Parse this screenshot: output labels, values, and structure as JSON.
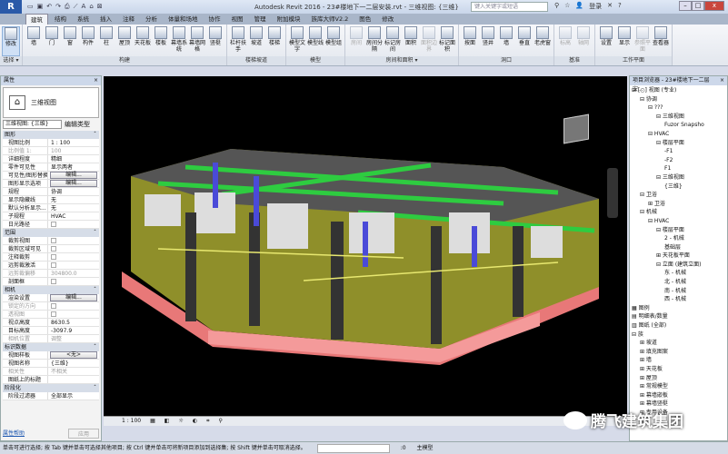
{
  "app": {
    "title": "Autodesk Revit 2016 -  23#楼地下一二层安装.rvt - 三维视图: {三维}",
    "search_placeholder": "键入关键字或短语",
    "signin": "登录"
  },
  "tabs": [
    "建筑",
    "结构",
    "系统",
    "插入",
    "注释",
    "分析",
    "体量和场地",
    "协作",
    "视图",
    "管理",
    "附加模块",
    "族库大师V2.2",
    "图色",
    "修改"
  ],
  "ribbon": {
    "panels": [
      {
        "label": "选择 ▾",
        "buttons": [
          {
            "label": "修改",
            "icon": "arrow"
          }
        ]
      },
      {
        "label": "构建",
        "buttons": [
          {
            "label": "墙",
            "icon": "wall"
          },
          {
            "label": "门",
            "icon": "door"
          },
          {
            "label": "窗",
            "icon": "window"
          },
          {
            "label": "构件",
            "icon": "component"
          },
          {
            "label": "柱",
            "icon": "column"
          },
          {
            "label": "屋顶",
            "icon": "roof"
          },
          {
            "label": "天花板",
            "icon": "ceiling"
          },
          {
            "label": "楼板",
            "icon": "floor"
          },
          {
            "label": "幕墙系统",
            "icon": "curtain-system"
          },
          {
            "label": "幕墙网格",
            "icon": "curtain-grid"
          },
          {
            "label": "竖梃",
            "icon": "mullion"
          }
        ]
      },
      {
        "label": "楼梯坡道",
        "buttons": [
          {
            "label": "栏杆扶手",
            "icon": "railing"
          },
          {
            "label": "坡道",
            "icon": "ramp"
          },
          {
            "label": "楼梯",
            "icon": "stair"
          }
        ]
      },
      {
        "label": "模型",
        "buttons": [
          {
            "label": "模型文字",
            "icon": "model-text"
          },
          {
            "label": "模型线",
            "icon": "model-line"
          },
          {
            "label": "模型组",
            "icon": "model-group"
          }
        ]
      },
      {
        "label": "房间和面积 ▾",
        "buttons": [
          {
            "label": "房间",
            "icon": "room",
            "disabled": true
          },
          {
            "label": "房间分隔",
            "icon": "room-separator"
          },
          {
            "label": "标记房间",
            "icon": "tag-room"
          },
          {
            "label": "面积",
            "icon": "area"
          },
          {
            "label": "面积边界",
            "icon": "area-boundary",
            "disabled": true
          },
          {
            "label": "标记面积",
            "icon": "tag-area"
          }
        ]
      },
      {
        "label": "洞口",
        "buttons": [
          {
            "label": "按面",
            "icon": "by-face"
          },
          {
            "label": "竖井",
            "icon": "shaft"
          },
          {
            "label": "墙",
            "icon": "wall-opening"
          },
          {
            "label": "垂直",
            "icon": "vertical"
          },
          {
            "label": "老虎窗",
            "icon": "dormer"
          }
        ]
      },
      {
        "label": "基准",
        "buttons": [
          {
            "label": "标高",
            "icon": "level",
            "disabled": true
          },
          {
            "label": "轴网",
            "icon": "grid",
            "disabled": true
          }
        ]
      },
      {
        "label": "工作平面",
        "buttons": [
          {
            "label": "设置",
            "icon": "set"
          },
          {
            "label": "显示",
            "icon": "show"
          },
          {
            "label": "参照平面",
            "icon": "ref-plane",
            "disabled": true
          },
          {
            "label": "查看器",
            "icon": "viewer"
          }
        ]
      }
    ]
  },
  "properties": {
    "title": "属性",
    "type_name": "三维视图",
    "selector": "三维视图: {三维}",
    "edit_type": "编辑类型",
    "groups": [
      {
        "name": "图形",
        "rows": [
          {
            "k": "视图比例",
            "v": "1 : 100"
          },
          {
            "k": "比例值 1:",
            "v": "100",
            "dim": true
          },
          {
            "k": "详细程度",
            "v": "精细"
          },
          {
            "k": "零件可见性",
            "v": "显示两者"
          },
          {
            "k": "可见性/图形替换",
            "v": "编辑...",
            "btn": true
          },
          {
            "k": "图形显示选项",
            "v": "编辑...",
            "btn": true
          },
          {
            "k": "规程",
            "v": "协调"
          },
          {
            "k": "显示隐藏线",
            "v": "无"
          },
          {
            "k": "默认分析显示...",
            "v": "无"
          },
          {
            "k": "子规程",
            "v": "HVAC"
          },
          {
            "k": "日光路径",
            "v": "",
            "chk": true
          }
        ]
      },
      {
        "name": "范围",
        "rows": [
          {
            "k": "裁剪视图",
            "v": "",
            "chk": true
          },
          {
            "k": "裁剪区域可见",
            "v": "",
            "chk": true
          },
          {
            "k": "注释裁剪",
            "v": "",
            "chk": true
          },
          {
            "k": "远剪裁激活",
            "v": "",
            "chk": true
          },
          {
            "k": "远剪裁偏移",
            "v": "304800.0",
            "dim": true
          },
          {
            "k": "剖面框",
            "v": "",
            "chk": true
          }
        ]
      },
      {
        "name": "相机",
        "rows": [
          {
            "k": "渲染设置",
            "v": "编辑...",
            "btn": true
          },
          {
            "k": "锁定的方向",
            "v": "",
            "chk": true,
            "dim": true
          },
          {
            "k": "透视图",
            "v": "",
            "chk": true,
            "dim": true
          },
          {
            "k": "视点高度",
            "v": "8630.5"
          },
          {
            "k": "目标高度",
            "v": "-3097.9"
          },
          {
            "k": "相机位置",
            "v": "调整",
            "dim": true
          }
        ]
      },
      {
        "name": "标识数据",
        "rows": [
          {
            "k": "视图样板",
            "v": "<无>",
            "btn": true
          },
          {
            "k": "视图名称",
            "v": "{三维}"
          },
          {
            "k": "相关性",
            "v": "不相关",
            "dim": true
          },
          {
            "k": "图纸上的标题",
            "v": ""
          }
        ]
      },
      {
        "name": "阶段化",
        "rows": [
          {
            "k": "阶段过滤器",
            "v": "全部显示"
          }
        ]
      }
    ],
    "help": "属性帮助",
    "apply": "应用"
  },
  "browser": {
    "title": "项目浏览器 - 23#楼地下一二层安...",
    "items": [
      {
        "t": "⊟ [○] 视图 (专业)",
        "d": 0
      },
      {
        "t": "⊟ 协调",
        "d": 1
      },
      {
        "t": "⊟ ???",
        "d": 2
      },
      {
        "t": "⊟ 三维视图",
        "d": 3
      },
      {
        "t": "Fuzor Snapsho",
        "d": 4
      },
      {
        "t": "⊟ HVAC",
        "d": 2
      },
      {
        "t": "⊟ 楼层平面",
        "d": 3
      },
      {
        "t": "-F1",
        "d": 4
      },
      {
        "t": "-F2",
        "d": 4
      },
      {
        "t": "F1",
        "d": 4
      },
      {
        "t": "⊟ 三维视图",
        "d": 3
      },
      {
        "t": "{三维}",
        "d": 4
      },
      {
        "t": "⊟ 卫浴",
        "d": 1
      },
      {
        "t": "⊞ 卫浴",
        "d": 2
      },
      {
        "t": "⊟ 机械",
        "d": 1
      },
      {
        "t": "⊟ HVAC",
        "d": 2
      },
      {
        "t": "⊟ 楼层平面",
        "d": 3
      },
      {
        "t": "2 - 机械",
        "d": 4
      },
      {
        "t": "基础层",
        "d": 4
      },
      {
        "t": "⊞ 天花板平面",
        "d": 3
      },
      {
        "t": "⊟ 立面 (建筑立面)",
        "d": 3
      },
      {
        "t": "东 - 机械",
        "d": 4
      },
      {
        "t": "北 - 机械",
        "d": 4
      },
      {
        "t": "南 - 机械",
        "d": 4
      },
      {
        "t": "西 - 机械",
        "d": 4
      },
      {
        "t": "▦ 图例",
        "d": 0
      },
      {
        "t": "▤ 明细表/数量",
        "d": 0
      },
      {
        "t": "▥ 图纸 (全部)",
        "d": 0
      },
      {
        "t": "⊟ 族",
        "d": 0
      },
      {
        "t": "⊞ 坡道",
        "d": 1
      },
      {
        "t": "⊞ 填充图案",
        "d": 1
      },
      {
        "t": "⊞ 墙",
        "d": 1
      },
      {
        "t": "⊞ 天花板",
        "d": 1
      },
      {
        "t": "⊞ 屋顶",
        "d": 1
      },
      {
        "t": "⊞ 常规模型",
        "d": 1
      },
      {
        "t": "⊞ 幕墙嵌板",
        "d": 1
      },
      {
        "t": "⊞ 幕墙竖梃",
        "d": 1
      },
      {
        "t": "⊞ 专用设备",
        "d": 1
      }
    ]
  },
  "viewbar": {
    "scale": "1 : 100"
  },
  "status": {
    "message": "单击可进行选择; 按 Tab 键并单击可选择其他项目; 按 Ctrl 键并单击可将新项目添加到选择集; 按 Shift 键并单击可取消选择。",
    "zero": ":0",
    "model": "主模型"
  },
  "watermark": "腾飞建筑集团",
  "colors": {
    "viewport": "#000000",
    "wall_yellow": "#a8a832",
    "floor_pink": "#f08080",
    "duct_green": "#3cb43c",
    "pipe_blue": "#4040d0"
  }
}
